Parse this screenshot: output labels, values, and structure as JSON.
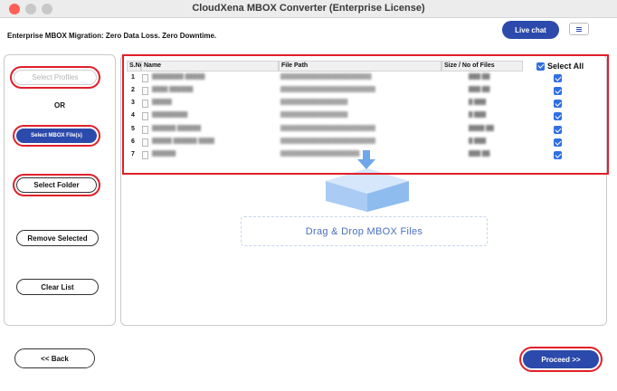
{
  "window": {
    "title": "CloudXena MBOX Converter (Enterprise License)"
  },
  "header": {
    "tagline": "Enterprise MBOX Migration: Zero Data Loss. Zero Downtime.",
    "live_chat_label": "Live chat",
    "menu_icon": "hamburger-icon"
  },
  "sidebar": {
    "select_profiles_label": "Select Profiles",
    "or_label": "OR",
    "select_mbox_label": "Select MBOX File(s)",
    "select_folder_label": "Select Folder",
    "remove_selected_label": "Remove Selected",
    "clear_list_label": "Clear List"
  },
  "file_list": {
    "columns": [
      "S.No",
      "Name",
      "File Path",
      "Size / No of Files"
    ],
    "select_all_label": "Select All",
    "select_all_checked": true,
    "rows": [
      {
        "sno": "1",
        "name": "▓▓▓▓▓▓▓▓ ▓▓▓▓▓",
        "path": "▓▓▓▓▓▓▓▓▓▓▓▓▓▓▓▓▓▓▓▓▓▓▓",
        "size": "▓▓▓ ▓▓",
        "checked": true
      },
      {
        "sno": "2",
        "name": "▓▓▓▓ ▓▓▓▓▓▓",
        "path": "▓▓▓▓▓▓▓▓▓▓▓▓▓▓▓▓▓▓▓▓▓▓▓▓",
        "size": "▓▓▓ ▓▓",
        "checked": true
      },
      {
        "sno": "3",
        "name": "▓▓▓▓▓",
        "path": "▓▓▓▓▓▓▓▓▓▓▓▓▓▓▓▓▓",
        "size": "▓ ▓▓▓",
        "checked": true
      },
      {
        "sno": "4",
        "name": "▓▓▓▓▓▓▓▓▓",
        "path": "▓▓▓▓▓▓▓▓▓▓▓▓▓▓▓▓▓",
        "size": "▓ ▓▓▓",
        "checked": true
      },
      {
        "sno": "5",
        "name": "▓▓▓▓▓▓ ▓▓▓▓▓▓",
        "path": "▓▓▓▓▓▓▓▓▓▓▓▓▓▓▓▓▓▓▓▓▓▓▓▓",
        "size": "▓▓▓▓ ▓▓",
        "checked": true
      },
      {
        "sno": "6",
        "name": "▓▓▓▓▓ ▓▓▓▓▓▓ ▓▓▓▓",
        "path": "▓▓▓▓▓▓▓▓▓▓▓▓▓▓▓▓▓▓▓▓▓▓▓▓",
        "size": "▓ ▓▓▓",
        "checked": true
      },
      {
        "sno": "7",
        "name": "▓▓▓▓▓▓",
        "path": "▓▓▓▓▓▓▓▓▓▓▓▓▓▓▓▓▓▓▓▓",
        "size": "▓▓▓ ▓▓",
        "checked": true
      }
    ]
  },
  "drop_zone": {
    "label": "Drag & Drop MBOX Files",
    "icon": "box-arrow-icon"
  },
  "footer": {
    "back_label": "<< Back",
    "proceed_label": "Proceed >>"
  },
  "colors": {
    "accent": "#2b4aab",
    "highlight": "#e0202a",
    "checkbox": "#2f6fe4"
  }
}
